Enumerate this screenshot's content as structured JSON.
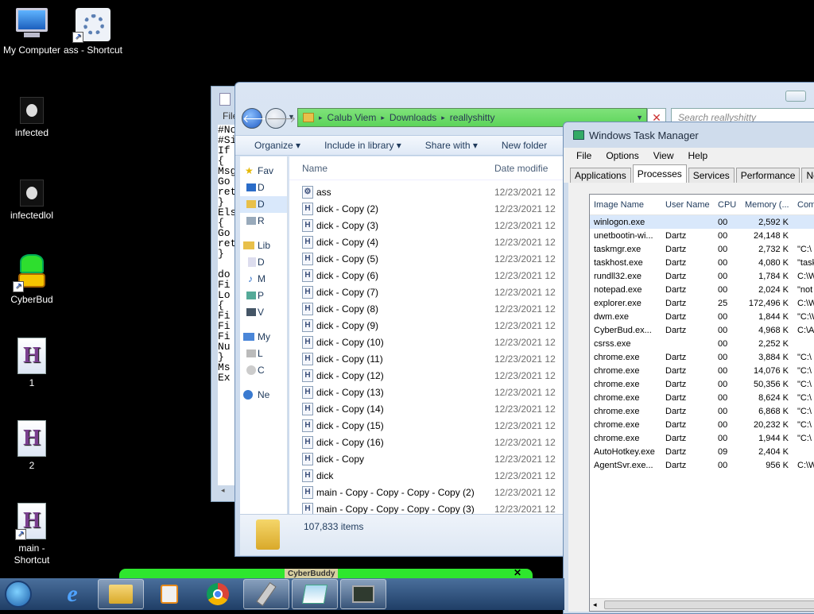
{
  "desktop": {
    "icons": [
      {
        "label": "My Computer"
      },
      {
        "label": "ass - Shortcut"
      },
      {
        "label": "infected"
      },
      {
        "label": "infectedlol"
      },
      {
        "label": "CyberBud"
      },
      {
        "label": "1"
      },
      {
        "label": "2"
      },
      {
        "label": "main -\nShortcut"
      }
    ]
  },
  "notepad": {
    "menu": "File",
    "lines": "#No\n#Si\nIf\n{\nMsg\nGo\nret\n}\nEls\n{\nGo\nret\n}\n\ndo\nFi\nLo\n{\nFi\nFi\nFi\nNu\n}\nMs\nEx"
  },
  "explorer": {
    "breadcrumb": [
      "Calub Viem",
      "Downloads",
      "reallyshitty"
    ],
    "search_placeholder": "Search reallyshitty",
    "toolbar": [
      "Organize",
      "Include in library",
      "Share with",
      "New folder"
    ],
    "nav": [
      "Fav",
      "D",
      "D",
      "R",
      "Lib",
      "D",
      "M",
      "P",
      "V",
      "My",
      "L",
      "C",
      "Ne"
    ],
    "col_name": "Name",
    "col_date": "Date modifie",
    "files": [
      {
        "name": "ass",
        "date": "12/23/2021 12"
      },
      {
        "name": "dick - Copy (2)",
        "date": "12/23/2021 12"
      },
      {
        "name": "dick - Copy (3)",
        "date": "12/23/2021 12"
      },
      {
        "name": "dick - Copy (4)",
        "date": "12/23/2021 12"
      },
      {
        "name": "dick - Copy (5)",
        "date": "12/23/2021 12"
      },
      {
        "name": "dick - Copy (6)",
        "date": "12/23/2021 12"
      },
      {
        "name": "dick - Copy (7)",
        "date": "12/23/2021 12"
      },
      {
        "name": "dick - Copy (8)",
        "date": "12/23/2021 12"
      },
      {
        "name": "dick - Copy (9)",
        "date": "12/23/2021 12"
      },
      {
        "name": "dick - Copy (10)",
        "date": "12/23/2021 12"
      },
      {
        "name": "dick - Copy (11)",
        "date": "12/23/2021 12"
      },
      {
        "name": "dick - Copy (12)",
        "date": "12/23/2021 12"
      },
      {
        "name": "dick - Copy (13)",
        "date": "12/23/2021 12"
      },
      {
        "name": "dick - Copy (14)",
        "date": "12/23/2021 12"
      },
      {
        "name": "dick - Copy (15)",
        "date": "12/23/2021 12"
      },
      {
        "name": "dick - Copy (16)",
        "date": "12/23/2021 12"
      },
      {
        "name": "dick - Copy",
        "date": "12/23/2021 12"
      },
      {
        "name": "dick",
        "date": "12/23/2021 12"
      },
      {
        "name": "main - Copy - Copy - Copy - Copy (2)",
        "date": "12/23/2021 12"
      },
      {
        "name": "main - Copy - Copy - Copy - Copy (3)",
        "date": "12/23/2021 12"
      }
    ],
    "status": "107,833 items"
  },
  "taskmgr": {
    "title": "Windows Task Manager",
    "menu": [
      "File",
      "Options",
      "View",
      "Help"
    ],
    "tabs": [
      "Applications",
      "Processes",
      "Services",
      "Performance",
      "Networki"
    ],
    "active_tab": "Processes",
    "headers": [
      "Image Name",
      "User Name",
      "CPU",
      "Memory (...",
      "Com"
    ],
    "processes": [
      {
        "name": "winlogon.exe",
        "user": "",
        "cpu": "00",
        "mem": "2,592 K",
        "cmd": ""
      },
      {
        "name": "unetbootin-wi...",
        "user": "Dartz",
        "cpu": "00",
        "mem": "24,148 K",
        "cmd": ""
      },
      {
        "name": "taskmgr.exe",
        "user": "Dartz",
        "cpu": "00",
        "mem": "2,732 K",
        "cmd": "\"C:\\"
      },
      {
        "name": "taskhost.exe",
        "user": "Dartz",
        "cpu": "00",
        "mem": "4,080 K",
        "cmd": "\"task"
      },
      {
        "name": "rundll32.exe",
        "user": "Dartz",
        "cpu": "00",
        "mem": "1,784 K",
        "cmd": "C:\\W"
      },
      {
        "name": "notepad.exe",
        "user": "Dartz",
        "cpu": "00",
        "mem": "2,024 K",
        "cmd": "\"not"
      },
      {
        "name": "explorer.exe",
        "user": "Dartz",
        "cpu": "25",
        "mem": "172,496 K",
        "cmd": "C:\\W"
      },
      {
        "name": "dwm.exe",
        "user": "Dartz",
        "cpu": "00",
        "mem": "1,844 K",
        "cmd": "\"C:\\W"
      },
      {
        "name": "CyberBud.ex...",
        "user": "Dartz",
        "cpu": "00",
        "mem": "4,968 K",
        "cmd": "C:\\A"
      },
      {
        "name": "csrss.exe",
        "user": "",
        "cpu": "00",
        "mem": "2,252 K",
        "cmd": ""
      },
      {
        "name": "chrome.exe",
        "user": "Dartz",
        "cpu": "00",
        "mem": "3,884 K",
        "cmd": "\"C:\\"
      },
      {
        "name": "chrome.exe",
        "user": "Dartz",
        "cpu": "00",
        "mem": "14,076 K",
        "cmd": "\"C:\\"
      },
      {
        "name": "chrome.exe",
        "user": "Dartz",
        "cpu": "00",
        "mem": "50,356 K",
        "cmd": "\"C:\\"
      },
      {
        "name": "chrome.exe",
        "user": "Dartz",
        "cpu": "00",
        "mem": "8,624 K",
        "cmd": "\"C:\\"
      },
      {
        "name": "chrome.exe",
        "user": "Dartz",
        "cpu": "00",
        "mem": "6,868 K",
        "cmd": "\"C:\\"
      },
      {
        "name": "chrome.exe",
        "user": "Dartz",
        "cpu": "00",
        "mem": "20,232 K",
        "cmd": "\"C:\\"
      },
      {
        "name": "chrome.exe",
        "user": "Dartz",
        "cpu": "00",
        "mem": "1,944 K",
        "cmd": "\"C:\\"
      },
      {
        "name": "AutoHotkey.exe",
        "user": "Dartz",
        "cpu": "09",
        "mem": "2,404 K",
        "cmd": ""
      },
      {
        "name": "AgentSvr.exe...",
        "user": "Dartz",
        "cpu": "00",
        "mem": "956 K",
        "cmd": "C:\\W"
      }
    ]
  },
  "cyberbuddy_bar": "CyberBuddy",
  "taskbar": {
    "items": [
      "start-button",
      "internet-explorer-icon",
      "file-explorer-icon",
      "media-player-icon",
      "chrome-icon",
      "usb-tool-icon",
      "notepad-icon",
      "task-manager-icon"
    ]
  }
}
